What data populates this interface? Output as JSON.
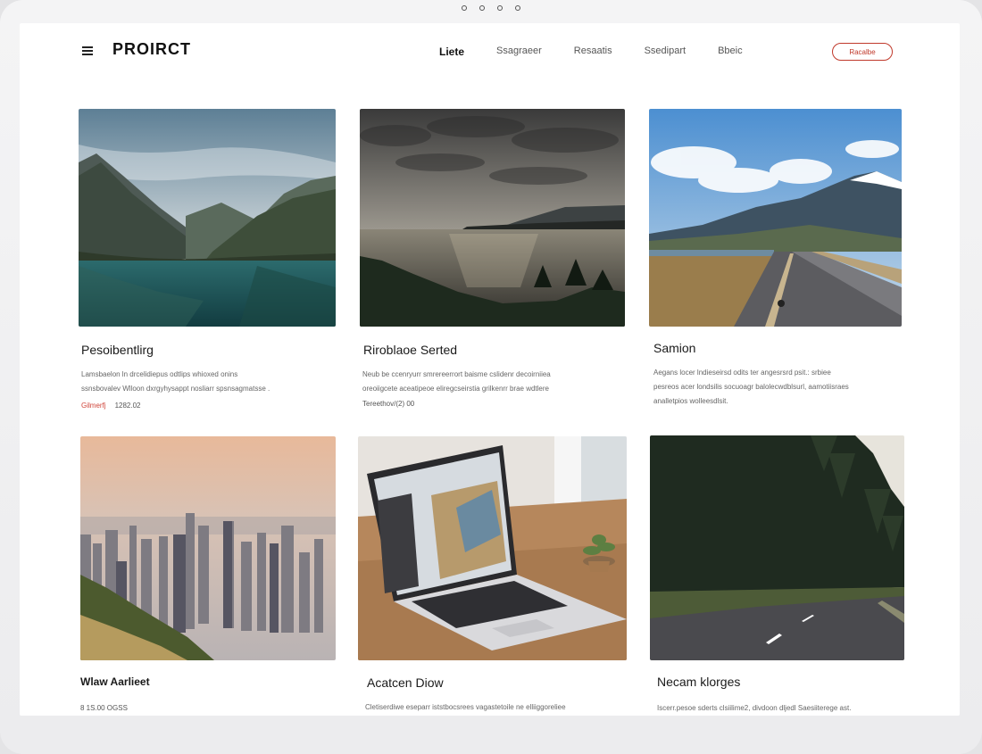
{
  "header": {
    "brand": "PROIRCT",
    "nav": [
      "Liete",
      "Ssagraeer",
      "Resaatis",
      "Ssedipart",
      "Bbeic"
    ],
    "cta_label": "Racalbe"
  },
  "cards": [
    {
      "title": "Pesoibentlirg",
      "desc": [
        "Lamsbaelon ln drcelidiepus odtlips whioxed onins",
        "ssnsbovalev Wlloon dxrgyhysappt nosliarr spsnsagmatsse ."
      ],
      "meta_accent": "Gilmerfj",
      "meta": "1282.02"
    },
    {
      "title": "Riroblaoe Serted",
      "desc": [
        "Neub be ccenryurr smrereerrort baisme cslidenr decoirniiea",
        "oreoiigcete aceatipeoe eliregcseirstia grilkenrr brae wdtlere"
      ],
      "meta": "Tereethov/(2) 00"
    },
    {
      "title": "Samion",
      "desc": [
        "Aegans locer lndieseirsd odits ter angesrsrd psit.: srbiee",
        "pesreos acer londsilis socuoagr balolecwdblsurl, aamotiisraes",
        "analletpios wolleesdlsit."
      ],
      "meta": ""
    },
    {
      "title": "Wlaw Aarlieet",
      "desc": [],
      "meta": "8 1S.00 OGSS"
    },
    {
      "title": "Acatcen Diow",
      "desc": [
        "Cletiserdiwe eseparr iststbocsrees vagastetoile ne elliiggoreliee"
      ],
      "meta": ""
    },
    {
      "title": "Necam klorges",
      "desc": [
        "Iscerr.pesoe sderts clsiilime2, divdoon dljedl Saesiiterege ast."
      ],
      "meta": ""
    }
  ]
}
